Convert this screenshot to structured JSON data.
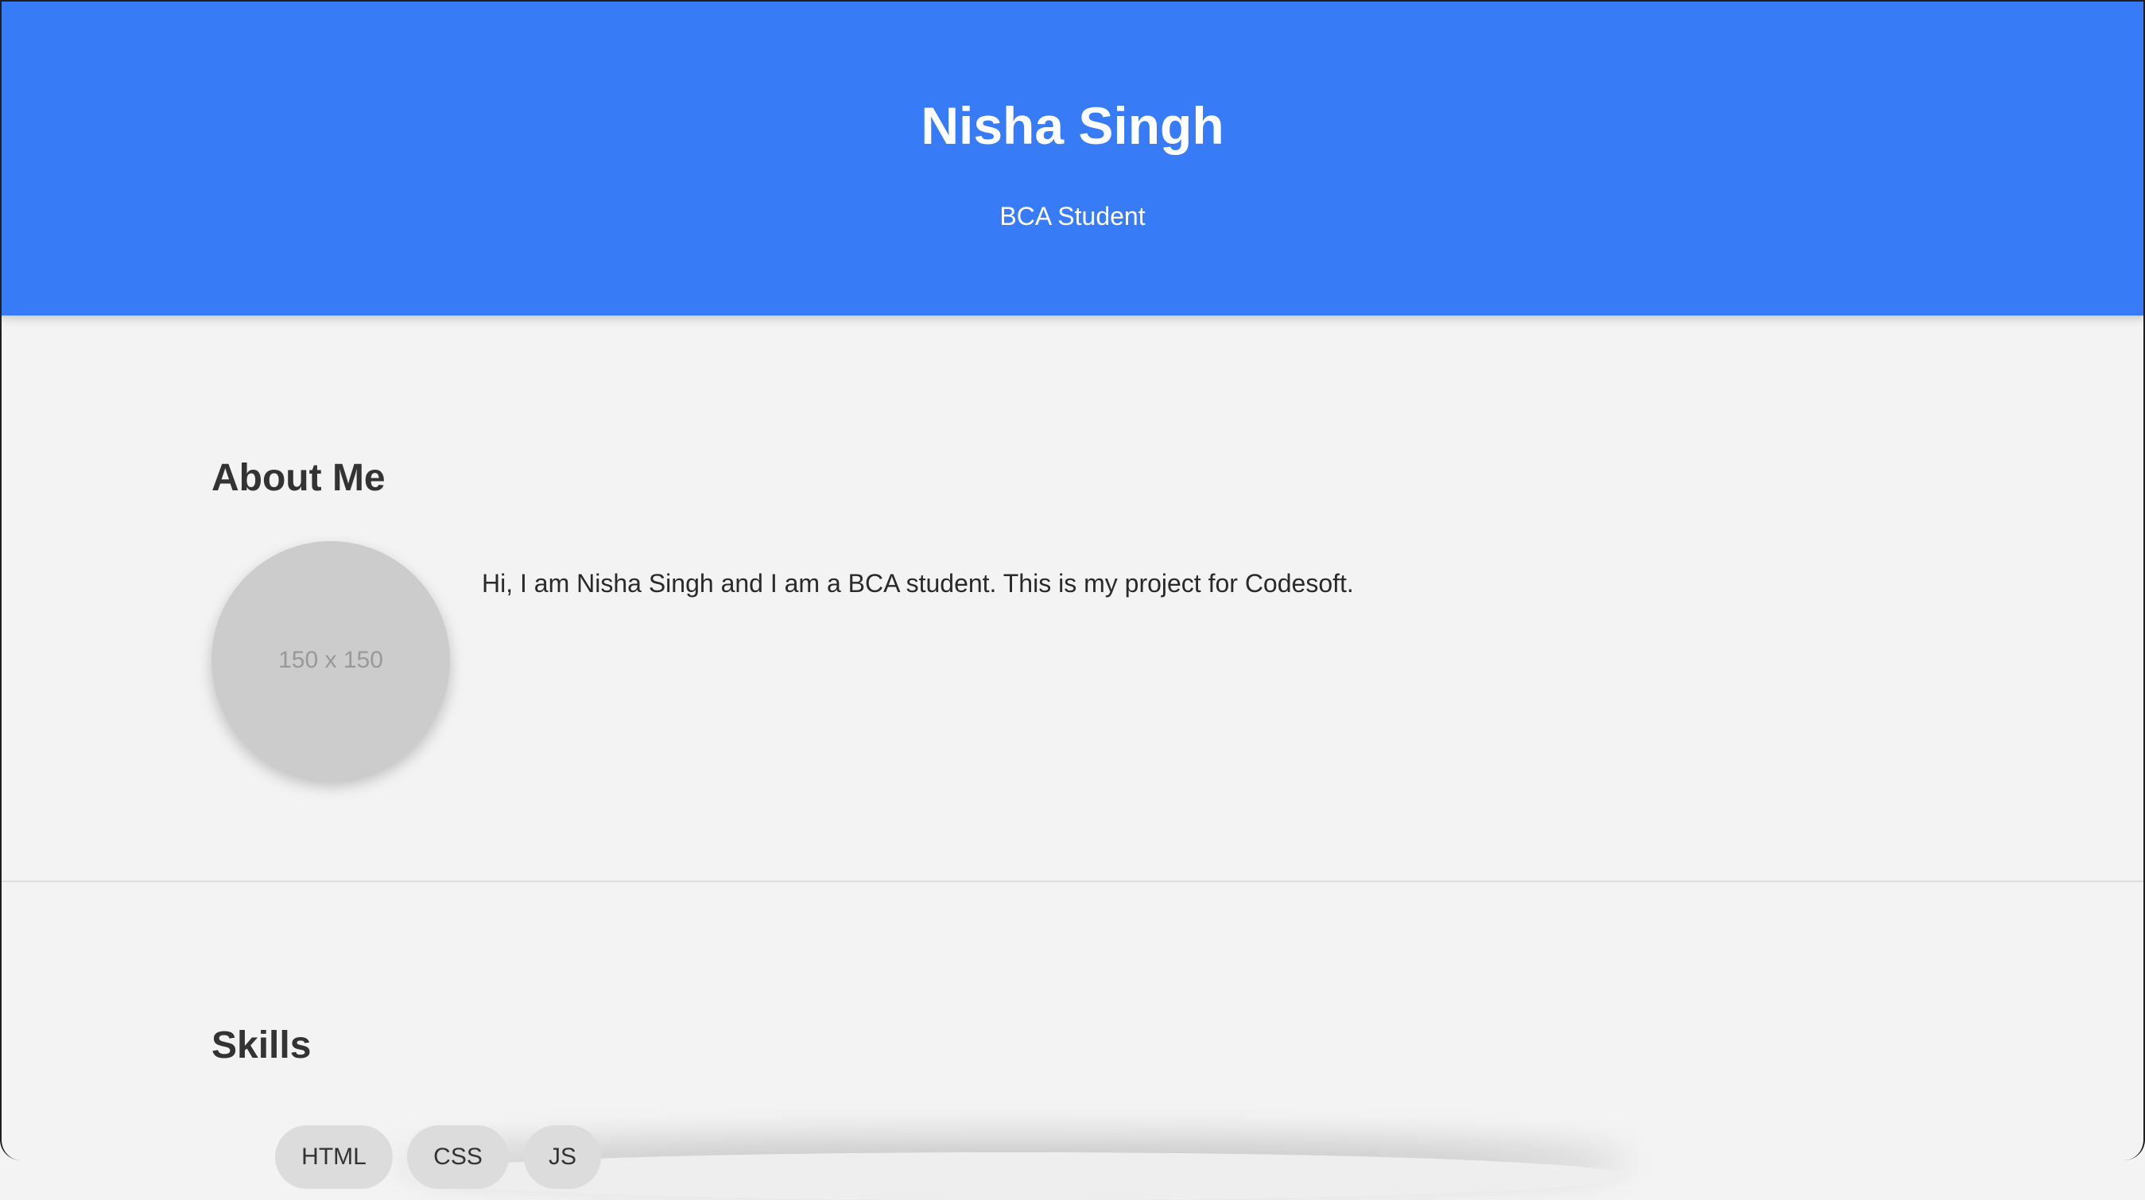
{
  "header": {
    "name": "Nisha Singh",
    "subtitle": "BCA Student",
    "background_color": "#377bf7"
  },
  "about": {
    "title": "About Me",
    "avatar_placeholder": "150 x 150",
    "text": "Hi, I am Nisha Singh and I am a BCA student. This is my project for Codesoft."
  },
  "skills": {
    "title": "Skills",
    "items": [
      {
        "label": "HTML"
      },
      {
        "label": "CSS"
      },
      {
        "label": "JS"
      }
    ]
  }
}
